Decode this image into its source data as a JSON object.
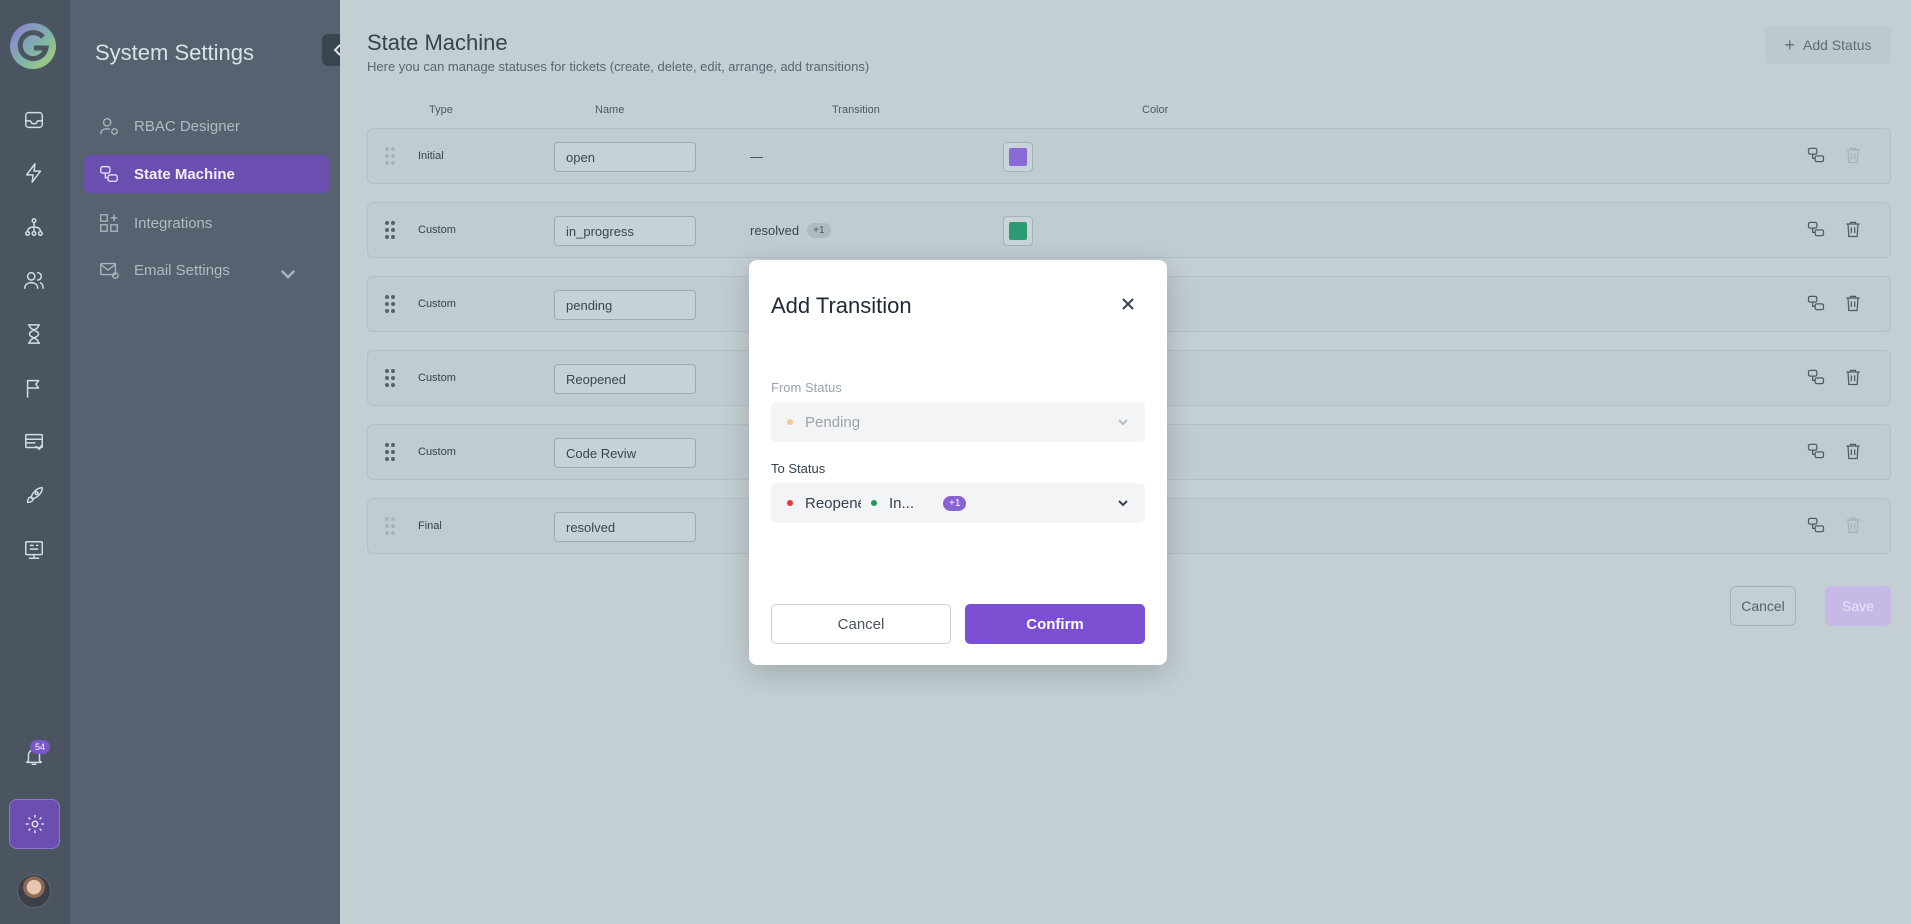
{
  "rail": {
    "notification_count": "54",
    "icons": [
      "inbox-icon",
      "lightning-icon",
      "hierarchy-icon",
      "users-icon",
      "hourglass-icon",
      "flag-icon",
      "table-arrow-icon",
      "rocket-icon",
      "presentation-icon"
    ]
  },
  "sidebar": {
    "title": "System Settings",
    "items": [
      {
        "label": "RBAC Designer",
        "icon": "user-gear-icon"
      },
      {
        "label": "State Machine",
        "icon": "state-machine-icon"
      },
      {
        "label": "Integrations",
        "icon": "integrations-icon"
      },
      {
        "label": "Email Settings",
        "icon": "email-settings-icon"
      }
    ]
  },
  "main": {
    "title": "State Machine",
    "subtitle": "Here you can manage statuses for tickets (create, delete, edit, arrange, add transitions)",
    "add_status": "Add Status",
    "headers": {
      "type": "Type",
      "name": "Name",
      "transition": "Transition",
      "color": "Color"
    },
    "rows": [
      {
        "type": "Initial",
        "name": "open",
        "transition": "—",
        "extra": "",
        "color": "#8a6bd6"
      },
      {
        "type": "Custom",
        "name": "in_progress",
        "transition": "resolved",
        "extra": "+1",
        "color": "#2e9a74"
      },
      {
        "type": "Custom",
        "name": "pending",
        "transition": "",
        "extra": "",
        "color": "#e6a94b"
      },
      {
        "type": "Custom",
        "name": "Reopened",
        "transition": "",
        "extra": "",
        "color": "#e05252"
      },
      {
        "type": "Custom",
        "name": "Code Reviw",
        "transition": "",
        "extra": "",
        "color": "#9be05a"
      },
      {
        "type": "Final",
        "name": "resolved",
        "transition": "",
        "extra": "",
        "color": "#4a5561"
      }
    ],
    "cancel": "Cancel",
    "save": "Save"
  },
  "modal": {
    "title": "Add Transition",
    "from_label": "From Status",
    "from_value": "Pending",
    "from_color": "#f5c98a",
    "to_label": "To Status",
    "to_values": [
      {
        "label": "Reopened",
        "color": "#e53935"
      },
      {
        "label": "In...",
        "color": "#1f9d55"
      }
    ],
    "to_more": "+1",
    "cancel": "Cancel",
    "confirm": "Confirm"
  }
}
